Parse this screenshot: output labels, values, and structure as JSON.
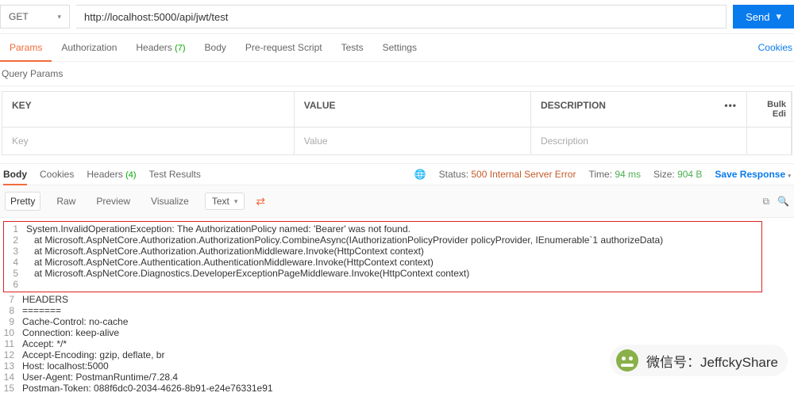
{
  "request": {
    "method": "GET",
    "url": "http://localhost:5000/api/jwt/test",
    "send_label": "Send"
  },
  "req_tabs": {
    "params": "Params",
    "authorization": "Authorization",
    "headers_label": "Headers",
    "headers_count": "(7)",
    "body": "Body",
    "prerequest": "Pre-request Script",
    "tests": "Tests",
    "settings": "Settings",
    "cookies": "Cookies"
  },
  "query_params": {
    "title": "Query Params",
    "hdr_key": "KEY",
    "hdr_value": "VALUE",
    "hdr_desc": "DESCRIPTION",
    "actions": "•••",
    "bulk": "Bulk Edi",
    "ph_key": "Key",
    "ph_value": "Value",
    "ph_desc": "Description"
  },
  "resp_tabs": {
    "body": "Body",
    "cookies": "Cookies",
    "headers_label": "Headers",
    "headers_count": "(4)",
    "test_results": "Test Results"
  },
  "status": {
    "status_label": "Status:",
    "status_value": "500 Internal Server Error",
    "time_label": "Time:",
    "time_value": "94 ms",
    "size_label": "Size:",
    "size_value": "904 B",
    "save": "Save Response"
  },
  "view": {
    "pretty": "Pretty",
    "raw": "Raw",
    "preview": "Preview",
    "visualize": "Visualize",
    "mode": "Text"
  },
  "body_lines": [
    "System.InvalidOperationException: The AuthorizationPolicy named: 'Bearer' was not found.",
    "   at Microsoft.AspNetCore.Authorization.AuthorizationPolicy.CombineAsync(IAuthorizationPolicyProvider policyProvider, IEnumerable`1 authorizeData)",
    "   at Microsoft.AspNetCore.Authorization.AuthorizationMiddleware.Invoke(HttpContext context)",
    "   at Microsoft.AspNetCore.Authentication.AuthenticationMiddleware.Invoke(HttpContext context)",
    "   at Microsoft.AspNetCore.Diagnostics.DeveloperExceptionPageMiddleware.Invoke(HttpContext context)",
    "",
    "HEADERS",
    "=======",
    "Cache-Control: no-cache",
    "Connection: keep-alive",
    "Accept: */*",
    "Accept-Encoding: gzip, deflate, br",
    "Host: localhost:5000",
    "User-Agent: PostmanRuntime/7.28.4",
    "Postman-Token: 088f6dc0-2034-4626-8b91-e24e76331e91"
  ],
  "watermark": {
    "prefix": "微信号",
    "sep": "：",
    "handle": "JeffckyShare"
  }
}
